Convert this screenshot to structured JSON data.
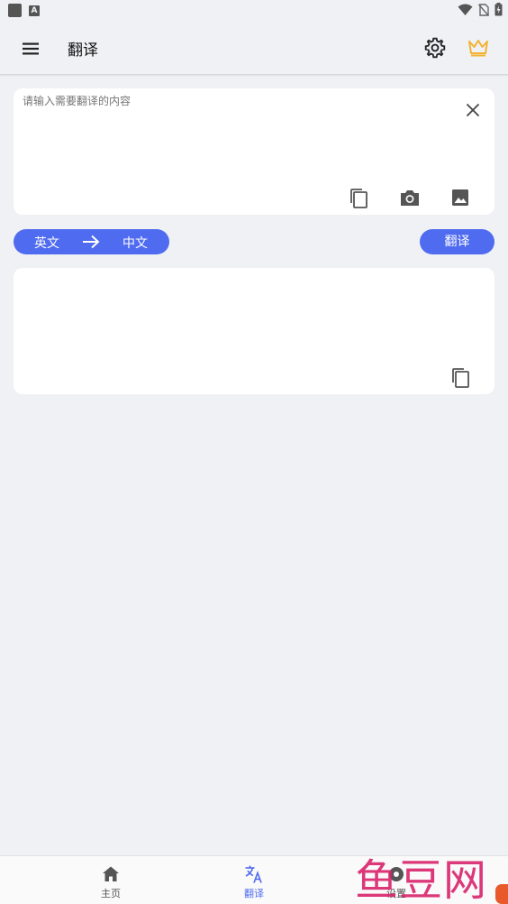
{
  "app_bar": {
    "title": "翻译"
  },
  "input": {
    "placeholder": "请输入需要翻译的内容",
    "value": ""
  },
  "language": {
    "from": "英文",
    "to": "中文"
  },
  "actions": {
    "translate_label": "翻译"
  },
  "bottom_nav": {
    "items": [
      {
        "label": "主页",
        "icon": "home-icon"
      },
      {
        "label": "翻译",
        "icon": "translate-icon",
        "active": true
      },
      {
        "label": "设置",
        "icon": "gear-icon"
      }
    ]
  },
  "watermark": {
    "text": "鱼豆网"
  },
  "colors": {
    "accent": "#4f6bef",
    "crown": "#f2b333",
    "background": "#f0f1f5",
    "watermark": "#d9246c"
  }
}
